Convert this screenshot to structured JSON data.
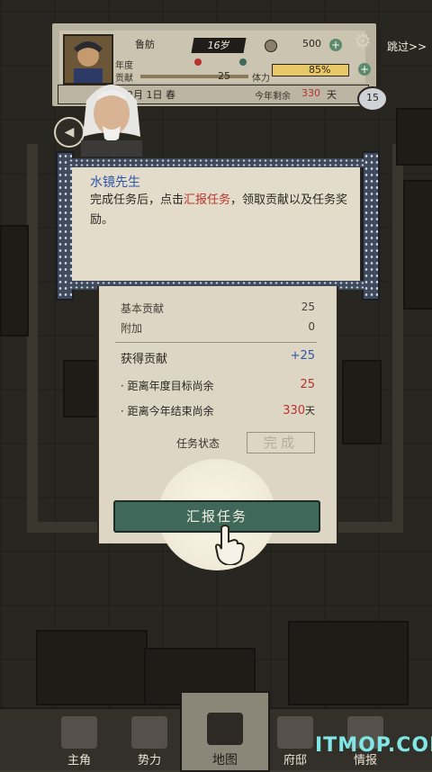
{
  "header": {
    "hero_name": "鲁舫",
    "age": "16岁",
    "coins": "500",
    "year_label": "年度",
    "contribution_label": "贡献",
    "contribution_value": "25",
    "power_label": "体力",
    "power_value": "85%",
    "power_level": 0.85,
    "date_text": "2月 1日  春",
    "remaining_label": "今年剩余",
    "remaining_days": "330",
    "remaining_unit": "天",
    "skip_label": "跳过>>",
    "badge_number": "15"
  },
  "dialog": {
    "speaker": "水镜先生",
    "text_before": "完成任务后，点击",
    "text_highlight": "汇报任务",
    "text_after": "，领取贡献以及任务奖励。"
  },
  "panel": {
    "rows": [
      {
        "label": "基本贡献",
        "value": "25"
      },
      {
        "label": "附加",
        "value": "0"
      },
      {
        "label": "获得贡献",
        "value": "+25"
      },
      {
        "label": "距离年度目标尚余",
        "value": "25"
      },
      {
        "label": "距离今年结束尚余",
        "value": "330",
        "unit": "天"
      }
    ],
    "status_label": "任务状态",
    "status_value": "完成",
    "report_button": "汇报任务"
  },
  "nav": {
    "tabs": [
      {
        "label": "主角"
      },
      {
        "label": "势力"
      },
      {
        "label": "地图"
      },
      {
        "label": "府邸"
      },
      {
        "label": "情报"
      }
    ],
    "active": "地图"
  },
  "watermark": "ITMOP.COM",
  "colors": {
    "accent_green": "#3f685a",
    "highlight_red": "#b8322e",
    "speaker_blue": "#2f57a8",
    "contribution_blue": "#2f57a8"
  }
}
